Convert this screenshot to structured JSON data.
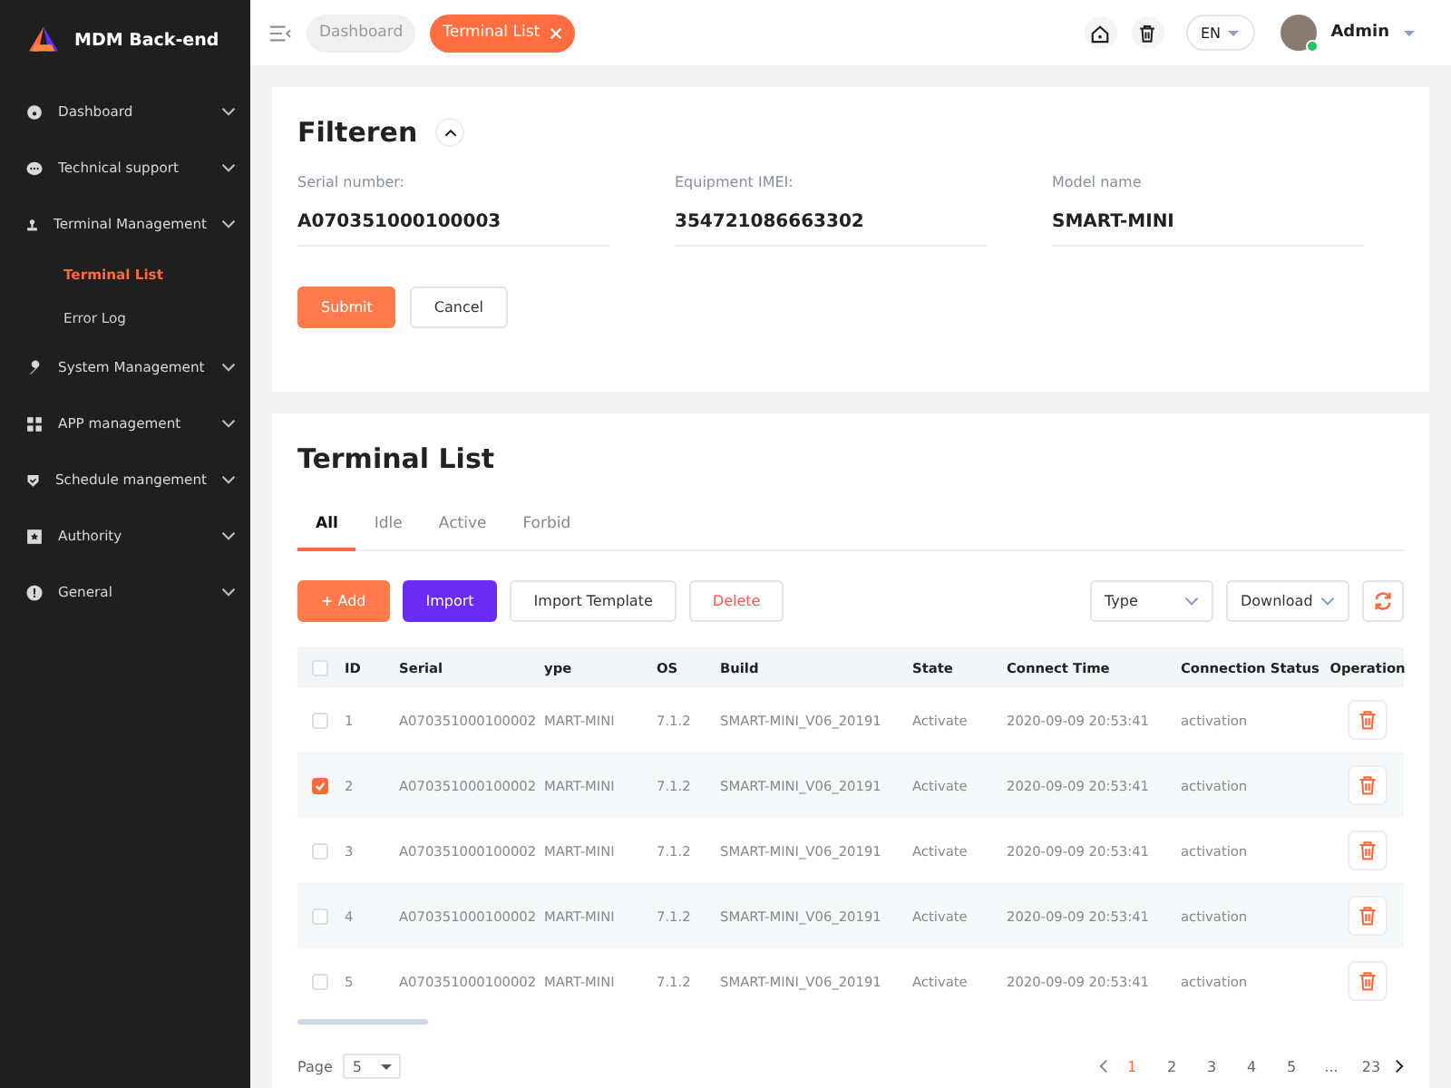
{
  "app": {
    "title": "MDM Back-end"
  },
  "sidebar": {
    "items": [
      {
        "label": "Dashboard"
      },
      {
        "label": "Technical support"
      },
      {
        "label": "Terminal Management",
        "children": [
          {
            "label": "Terminal List",
            "selected": true
          },
          {
            "label": "Error Log",
            "selected": false
          }
        ]
      },
      {
        "label": "System Management"
      },
      {
        "label": "APP management"
      },
      {
        "label": "Schedule mangement"
      },
      {
        "label": "Authority"
      },
      {
        "label": "General"
      }
    ]
  },
  "topbar": {
    "tags": [
      {
        "label": "Dashboard",
        "selected": false
      },
      {
        "label": "Terminal List",
        "selected": true
      }
    ],
    "language": "EN",
    "user": "Admin",
    "online": true
  },
  "filter": {
    "title": "Filteren",
    "expanded": true,
    "fields": [
      {
        "label": "Serial number:",
        "value": "A070351000100003"
      },
      {
        "label": "Equipment IMEI:",
        "value": "354721086663302"
      },
      {
        "label": "Model name",
        "value": "SMART-MINI"
      }
    ],
    "buttons": [
      {
        "label": "Submit",
        "kind": "primary"
      },
      {
        "label": "Cancel",
        "kind": "default"
      }
    ]
  },
  "list": {
    "title": "Terminal List",
    "tabs": [
      {
        "label": "All",
        "selected": true
      },
      {
        "label": "Idle",
        "selected": false
      },
      {
        "label": "Active",
        "selected": false
      },
      {
        "label": "Forbid",
        "selected": false
      }
    ],
    "buttons": [
      {
        "label": "+ Add",
        "kind": "primary"
      },
      {
        "label": "Import",
        "kind": "accent"
      },
      {
        "label": "Import Template",
        "kind": "default"
      },
      {
        "label": "Delete",
        "kind": "danger"
      }
    ],
    "selects": [
      "Type",
      "Download"
    ],
    "table": {
      "all_checked": false,
      "columns": [
        "ID",
        "Serial",
        "ype",
        "OS",
        "Build",
        "State",
        "Connect Time",
        "Connection Status",
        "Operation"
      ],
      "rows": [
        {
          "checked": false,
          "cells": [
            "1",
            "A070351000100002",
            "MART-MINI",
            "7.1.2",
            "SMART-MINI_V06_20191",
            "Activate",
            "2020-09-09 20:53:41",
            "activation"
          ]
        },
        {
          "checked": true,
          "cells": [
            "2",
            "A070351000100002",
            "MART-MINI",
            "7.1.2",
            "SMART-MINI_V06_20191",
            "Activate",
            "2020-09-09 20:53:41",
            "activation"
          ]
        },
        {
          "checked": false,
          "cells": [
            "3",
            "A070351000100002",
            "MART-MINI",
            "7.1.2",
            "SMART-MINI_V06_20191",
            "Activate",
            "2020-09-09 20:53:41",
            "activation"
          ]
        },
        {
          "checked": false,
          "cells": [
            "4",
            "A070351000100002",
            "MART-MINI",
            "7.1.2",
            "SMART-MINI_V06_20191",
            "Activate",
            "2020-09-09 20:53:41",
            "activation"
          ]
        },
        {
          "checked": false,
          "cells": [
            "5",
            "A070351000100002",
            "MART-MINI",
            "7.1.2",
            "SMART-MINI_V06_20191",
            "Activate",
            "2020-09-09 20:53:41",
            "activation"
          ]
        }
      ]
    },
    "pagination": {
      "label": "Page",
      "page_size": "5",
      "pages": [
        {
          "label": "1",
          "selected": true
        },
        {
          "label": "2",
          "selected": false
        },
        {
          "label": "3",
          "selected": false
        },
        {
          "label": "4",
          "selected": false
        },
        {
          "label": "5",
          "selected": false
        },
        {
          "label": "...",
          "selected": false
        },
        {
          "label": "23",
          "selected": false
        }
      ]
    }
  }
}
